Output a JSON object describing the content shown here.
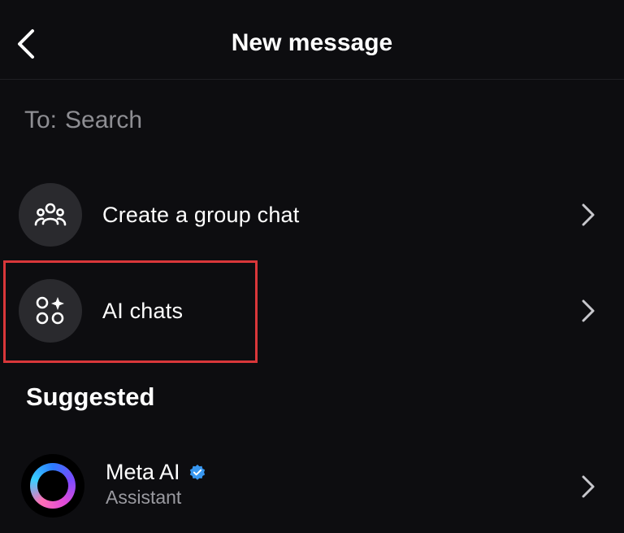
{
  "header": {
    "title": "New message",
    "back_icon": "chevron-left-icon"
  },
  "recipient": {
    "prefix": "To:",
    "placeholder": "Search",
    "value": ""
  },
  "actions": [
    {
      "label": "Create a group chat",
      "icon": "group-icon"
    },
    {
      "label": "AI chats",
      "icon": "ai-chats-icon"
    }
  ],
  "suggested": {
    "heading": "Suggested",
    "items": [
      {
        "name": "Meta AI",
        "subtitle": "Assistant",
        "verified": true,
        "icon": "meta-ai-ring-icon"
      }
    ]
  },
  "colors": {
    "background": "#0d0d10",
    "circle": "#2a2a2e",
    "highlight": "#d9373a",
    "verified": "#3897f0",
    "secondary_text": "#8e8e93"
  }
}
